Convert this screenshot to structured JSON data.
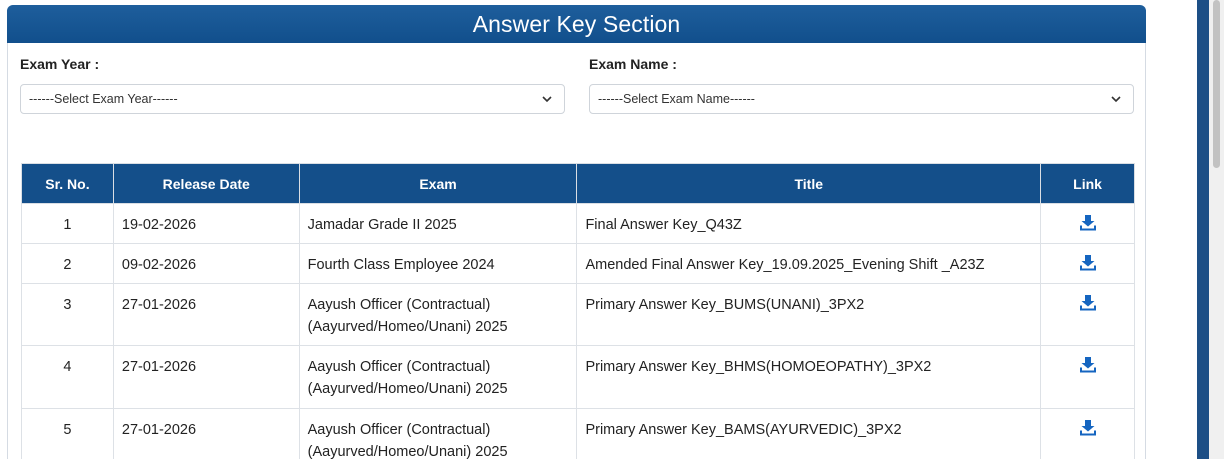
{
  "panel": {
    "title": "Answer Key Section"
  },
  "filters": {
    "exam_year": {
      "label": "Exam Year :",
      "selected": "------Select Exam Year------"
    },
    "exam_name": {
      "label": "Exam Name :",
      "selected": "------Select Exam Name------"
    }
  },
  "table": {
    "columns": [
      "Sr. No.",
      "Release Date",
      "Exam",
      "Title",
      "Link"
    ],
    "rows": [
      {
        "sr": "1",
        "date": "19-02-2026",
        "exam": "Jamadar Grade II 2025",
        "title": "Final Answer Key_Q43Z",
        "link_icon": "download-icon"
      },
      {
        "sr": "2",
        "date": "09-02-2026",
        "exam": "Fourth Class Employee 2024",
        "title": "Amended Final Answer Key_19.09.2025_Evening Shift _A23Z",
        "link_icon": "download-icon"
      },
      {
        "sr": "3",
        "date": "27-01-2026",
        "exam": "Aayush Officer (Contractual) (Aayurved/Homeo/Unani) 2025",
        "title": "Primary Answer Key_BUMS(UNANI)_3PX2",
        "link_icon": "download-icon"
      },
      {
        "sr": "4",
        "date": "27-01-2026",
        "exam": "Aayush Officer (Contractual) (Aayurved/Homeo/Unani) 2025",
        "title": "Primary Answer Key_BHMS(HOMOEOPATHY)_3PX2",
        "link_icon": "download-icon"
      },
      {
        "sr": "5",
        "date": "27-01-2026",
        "exam": "Aayush Officer (Contractual) (Aayurved/Homeo/Unani) 2025",
        "title": "Primary Answer Key_BAMS(AYURVEDIC)_3PX2",
        "link_icon": "download-icon"
      }
    ]
  },
  "colors": {
    "header_blue": "#144f8a",
    "icon_blue": "#1565c0"
  }
}
